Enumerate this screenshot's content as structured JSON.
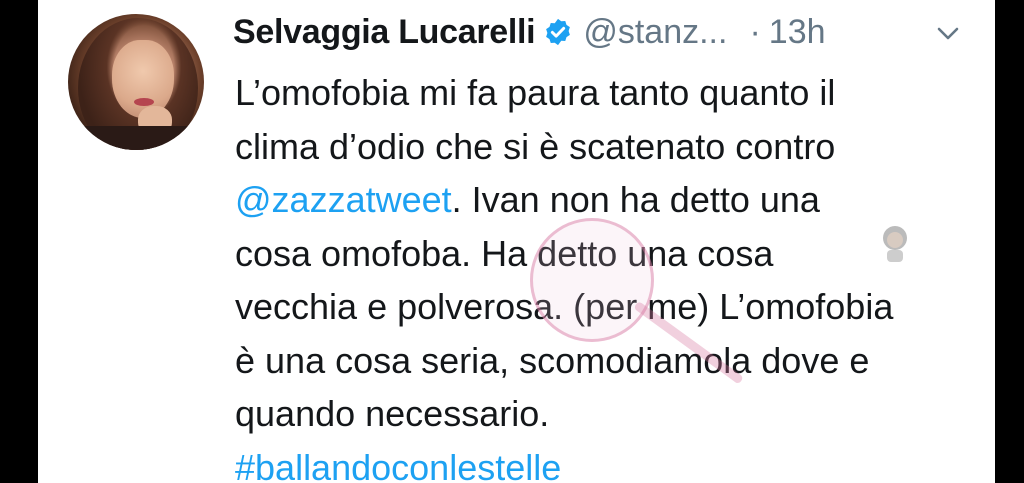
{
  "tweet": {
    "author_name": "Selvaggia Lucarelli",
    "handle": "@stanz...",
    "separator": "·",
    "time": "13h",
    "lines": [
      {
        "parts": [
          {
            "text": "L’omofobia mi fa paura tanto quanto il",
            "link": false
          }
        ]
      },
      {
        "parts": [
          {
            "text": "clima d’odio che si è scatenato contro",
            "link": false
          }
        ]
      },
      {
        "parts": [
          {
            "text": "@zazzatweet",
            "link": true
          },
          {
            "text": ". Ivan non ha detto una",
            "link": false
          }
        ]
      },
      {
        "parts": [
          {
            "text": "cosa omofoba. Ha detto una cosa",
            "link": false
          }
        ]
      },
      {
        "parts": [
          {
            "text": "vecchia e polverosa. (per me) L’omofobia",
            "link": false
          }
        ]
      },
      {
        "parts": [
          {
            "text": "è una cosa seria, scomodiamola dove e",
            "link": false
          }
        ]
      },
      {
        "parts": [
          {
            "text": "quando necessario.",
            "link": false
          }
        ]
      },
      {
        "parts": [
          {
            "text": "#ballandoconlestelle",
            "link": true
          }
        ]
      }
    ]
  },
  "icons": {
    "verified": "verified-badge-icon",
    "menu": "chevron-down-icon",
    "avatar": "profile-avatar"
  },
  "colors": {
    "link": "#1da1f2",
    "text": "#14171a",
    "muted": "#657786",
    "verified": "#1da1f2",
    "background": "#ffffff",
    "frame": "#000000"
  }
}
